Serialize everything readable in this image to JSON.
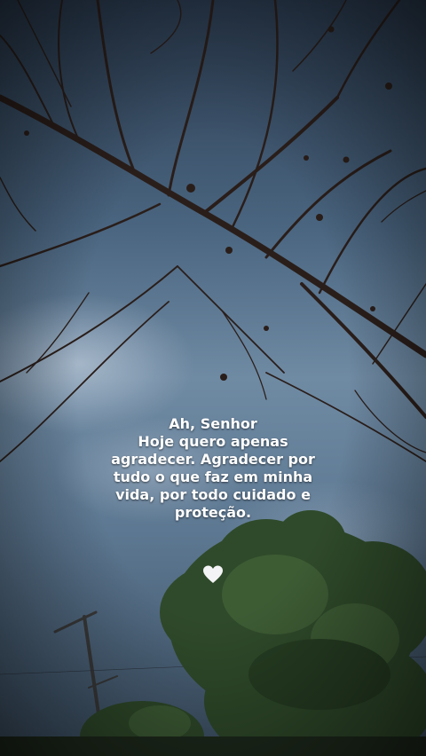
{
  "caption": {
    "line1": "Ah, Senhor",
    "line2": "Hoje quero apenas",
    "line3": "agradecer. Agradecer por",
    "line4": "tudo o que faz em minha",
    "line5": "vida, por todo cuidado e",
    "line6": "proteção."
  },
  "decorations": {
    "heart": "white-heart-icon"
  },
  "colors": {
    "sky": "#5f7b96",
    "branches": "#2a1e1a",
    "foliage": "#2f4a2a",
    "text": "#ffffff"
  }
}
